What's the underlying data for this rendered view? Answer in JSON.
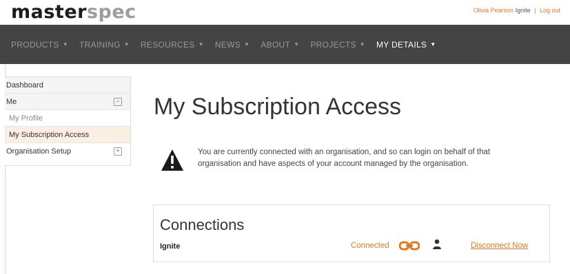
{
  "header": {
    "logo_part1": "master",
    "logo_part2": "spec",
    "user_name": "Olivia Pearson",
    "org_name": "Ignite",
    "separator": "|",
    "logout_label": "Log out"
  },
  "nav": {
    "items": [
      {
        "label": "PRODUCTS",
        "caret": "▼"
      },
      {
        "label": "TRAINING",
        "caret": "▼"
      },
      {
        "label": "RESOURCES",
        "caret": "▼"
      },
      {
        "label": "NEWS",
        "caret": "▼"
      },
      {
        "label": "ABOUT",
        "caret": "▼"
      },
      {
        "label": "PROJECTS",
        "caret": "▼"
      },
      {
        "label": "MY DETAILS",
        "caret": "▼"
      }
    ]
  },
  "sidebar": {
    "items": [
      {
        "label": "Dashboard"
      },
      {
        "label": "Me",
        "toggle": "−"
      },
      {
        "label": "My Profile"
      },
      {
        "label": "My Subscription Access"
      },
      {
        "label": "Organisation Setup",
        "toggle": "+"
      }
    ]
  },
  "main": {
    "title": "My Subscription Access",
    "notice": "You are currently connected with an organisation, and so can login on behalf of that organisation and have aspects of your account managed by the organisation.",
    "warning_icon": "warning-triangle-icon"
  },
  "connections": {
    "title": "Connections",
    "rows": [
      {
        "name": "Ignite",
        "status": "Connected",
        "link_icon": "chain-link-icon",
        "person_icon": "person-icon",
        "action": "Disconnect Now"
      }
    ]
  },
  "colors": {
    "accent": "#e07a1f",
    "nav_bg": "#444444",
    "nav_text": "#9a9a9a",
    "nav_active": "#ffffff",
    "selected_bg": "#fbeee2"
  }
}
